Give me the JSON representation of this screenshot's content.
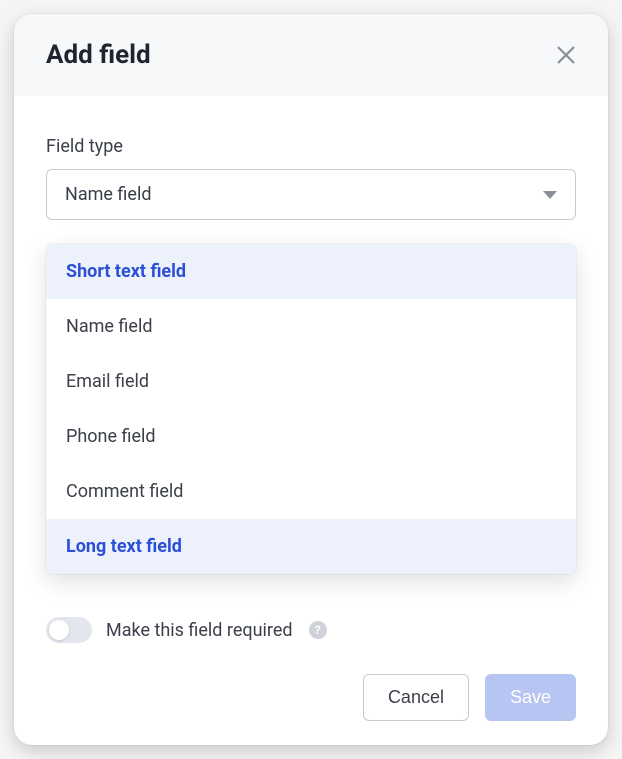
{
  "modal": {
    "title": "Add field",
    "field_type_label": "Field type",
    "selected_value": "Name field",
    "dropdown": {
      "items": [
        {
          "label": "Short text field",
          "group_header": true
        },
        {
          "label": "Name field",
          "group_header": false
        },
        {
          "label": "Email field",
          "group_header": false
        },
        {
          "label": "Phone field",
          "group_header": false
        },
        {
          "label": "Comment field",
          "group_header": false
        },
        {
          "label": "Long text field",
          "group_header": true
        }
      ]
    },
    "required_toggle_label": "Make this field required",
    "footer": {
      "cancel_label": "Cancel",
      "save_label": "Save"
    }
  }
}
